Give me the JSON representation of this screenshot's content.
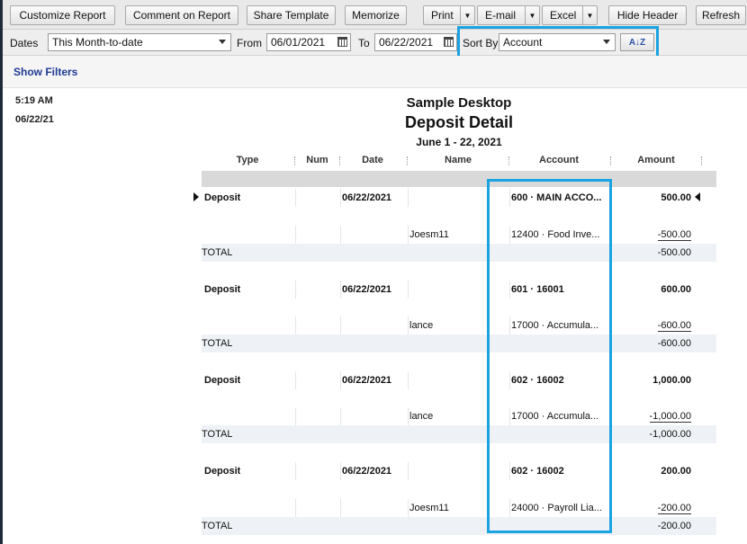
{
  "toolbar": {
    "customize": "Customize Report",
    "comment": "Comment on Report",
    "share": "Share Template",
    "memorize": "Memorize",
    "print": "Print",
    "email": "E-mail",
    "excel": "Excel",
    "hide_header": "Hide Header",
    "refresh": "Refresh"
  },
  "filters": {
    "dates_label": "Dates",
    "dates_value": "This Month-to-date",
    "from_label": "From",
    "from_value": "06/01/2021",
    "to_label": "To",
    "to_value": "06/22/2021",
    "sort_label": "Sort By",
    "sort_value": "Account",
    "sort_dir_icon": "A↓Z"
  },
  "show_filters": "Show Filters",
  "report": {
    "time": "5:19 AM",
    "date": "06/22/21",
    "company": "Sample Desktop",
    "title": "Deposit Detail",
    "period": "June 1 - 22, 2021",
    "columns": [
      "Type",
      "Num",
      "Date",
      "Name",
      "Account",
      "Amount"
    ],
    "groups": [
      {
        "deposit": {
          "type": "Deposit",
          "date": "06/22/2021",
          "account": "600 · MAIN ACCO...",
          "amount": "500.00"
        },
        "split": {
          "name": "Joesm11",
          "account": "12400 · Food Inve...",
          "amount": "-500.00"
        },
        "total": {
          "label": "TOTAL",
          "amount": "-500.00"
        }
      },
      {
        "deposit": {
          "type": "Deposit",
          "date": "06/22/2021",
          "account": "601 · 16001",
          "amount": "600.00"
        },
        "split": {
          "name": "lance",
          "account": "17000 · Accumula...",
          "amount": "-600.00"
        },
        "total": {
          "label": "TOTAL",
          "amount": "-600.00"
        }
      },
      {
        "deposit": {
          "type": "Deposit",
          "date": "06/22/2021",
          "account": "602 · 16002",
          "amount": "1,000.00"
        },
        "split": {
          "name": "lance",
          "account": "17000 · Accumula...",
          "amount": "-1,000.00"
        },
        "total": {
          "label": "TOTAL",
          "amount": "-1,000.00"
        }
      },
      {
        "deposit": {
          "type": "Deposit",
          "date": "06/22/2021",
          "account": "602 · 16002",
          "amount": "200.00"
        },
        "split": {
          "name": "Joesm11",
          "account": "24000 · Payroll Lia...",
          "amount": "-200.00"
        },
        "total": {
          "label": "TOTAL",
          "amount": "-200.00"
        }
      }
    ]
  },
  "colors": {
    "highlight": "#1aa3e0",
    "link": "#1f3a93"
  }
}
